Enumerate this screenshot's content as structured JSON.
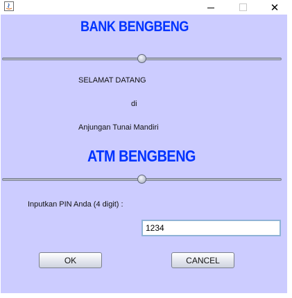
{
  "window": {
    "icon": "java-app-icon",
    "controls": {
      "minimize": "minimize-icon",
      "maximize": "maximize-icon",
      "close": "close-icon",
      "close_glyph": "✕"
    }
  },
  "header": {
    "bank_title": "BANK BENGBENG"
  },
  "welcome": {
    "line1": "SELAMAT DATANG",
    "line2": "di",
    "line3": "Anjungan Tunai Mandiri"
  },
  "atm_title": "ATM BENGBENG",
  "sliders": {
    "top_value": 0.5,
    "bottom_value": 0.5
  },
  "pin": {
    "label": "Inputkan PIN Anda (4 digit) :",
    "value": "1234"
  },
  "buttons": {
    "ok": "OK",
    "cancel": "CANCEL"
  },
  "colors": {
    "background": "#ccccff",
    "title": "#0033ff"
  }
}
